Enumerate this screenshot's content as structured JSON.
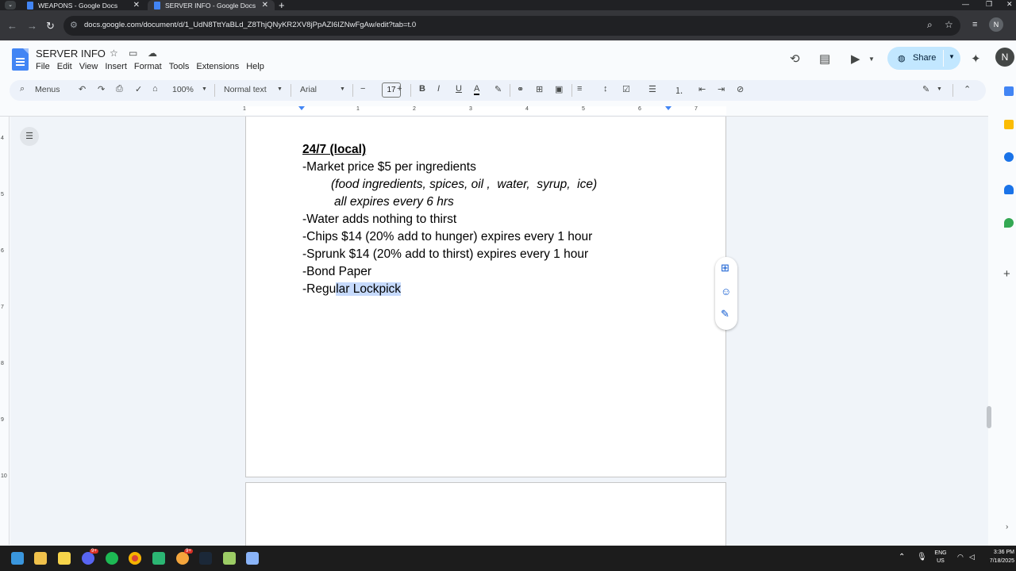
{
  "browser": {
    "tabs": [
      {
        "title": "WEAPONS - Google Docs",
        "active": false
      },
      {
        "title": "SERVER INFO - Google Docs",
        "active": true
      }
    ],
    "url": "docs.google.com/document/d/1_UdN8TttYaBLd_Z8ThjQNyKR2XV8jPpAZI6IZNwFgAw/edit?tab=t.0",
    "profile_initial": "N"
  },
  "docs": {
    "title": "SERVER INFO",
    "menu": [
      "File",
      "Edit",
      "View",
      "Insert",
      "Format",
      "Tools",
      "Extensions",
      "Help"
    ],
    "share_label": "Share",
    "avatar_initial": "N",
    "toolbar": {
      "search_label": "Menus",
      "zoom": "100%",
      "style": "Normal text",
      "font": "Arial",
      "font_size": "17"
    },
    "ruler_numbers": [
      "1",
      "1",
      "2",
      "3",
      "4",
      "5",
      "6",
      "7"
    ],
    "vruler_numbers": [
      "4",
      "5",
      "6",
      "7",
      "8",
      "9",
      "10"
    ]
  },
  "document": {
    "heading": "24/7 (local)",
    "lines": [
      "-Market price $5 per ingredients",
      "(food ingredients, spices, oil ,  water,  syrup,  ice)",
      "all expires every 6 hrs",
      "-Water adds nothing to thirst",
      "-Chips $14 (20% add to hunger) expires every 1 hour",
      "-Sprunk $14 (20% add to thirst) expires every 1 hour",
      "-Bond Paper"
    ],
    "last_line_prefix": "-Regu",
    "last_line_selected": "lar Lockpick"
  },
  "taskbar": {
    "lang": "ENG",
    "region": "US",
    "time": "3:36 PM",
    "date": "7/18/2025",
    "badge1": "9+",
    "badge2": "9+"
  },
  "colors": {
    "accent": "#0b57d0",
    "share_bg": "#c2e7ff",
    "selection": "#c6dafc",
    "docs_blue": "#4285f4"
  }
}
